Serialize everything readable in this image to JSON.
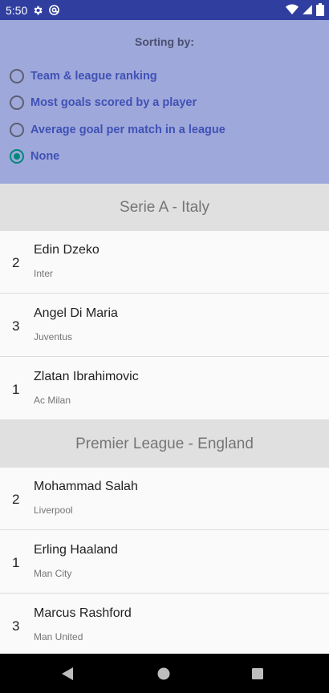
{
  "status_bar": {
    "time": "5:50",
    "left_icons": [
      "gear-icon",
      "at-sign-icon"
    ],
    "right_icons": [
      "wifi-icon",
      "signal-icon",
      "battery-icon"
    ]
  },
  "sorting": {
    "title": "Sorting by:",
    "options": [
      {
        "label": "Team & league ranking",
        "checked": false
      },
      {
        "label": "Most goals scored by a player",
        "checked": false
      },
      {
        "label": "Average goal per match in a league",
        "checked": false
      },
      {
        "label": "None",
        "checked": true
      }
    ],
    "accent_color": "#00897b",
    "label_color": "#3f51b5"
  },
  "leagues": [
    {
      "name": "Serie A - Italy",
      "players": [
        {
          "rank": "2",
          "name": "Edin Dzeko",
          "team": "Inter"
        },
        {
          "rank": "3",
          "name": "Angel Di Maria",
          "team": "Juventus"
        },
        {
          "rank": "1",
          "name": "Zlatan Ibrahimovic",
          "team": "Ac Milan"
        }
      ]
    },
    {
      "name": "Premier League - England",
      "players": [
        {
          "rank": "2",
          "name": "Mohammad Salah",
          "team": "Liverpool"
        },
        {
          "rank": "1",
          "name": "Erling Haaland",
          "team": "Man City"
        },
        {
          "rank": "3",
          "name": "Marcus Rashford",
          "team": "Man United"
        }
      ]
    }
  ],
  "nav_bar": {
    "buttons": [
      "back-icon",
      "home-icon",
      "recents-icon"
    ]
  }
}
